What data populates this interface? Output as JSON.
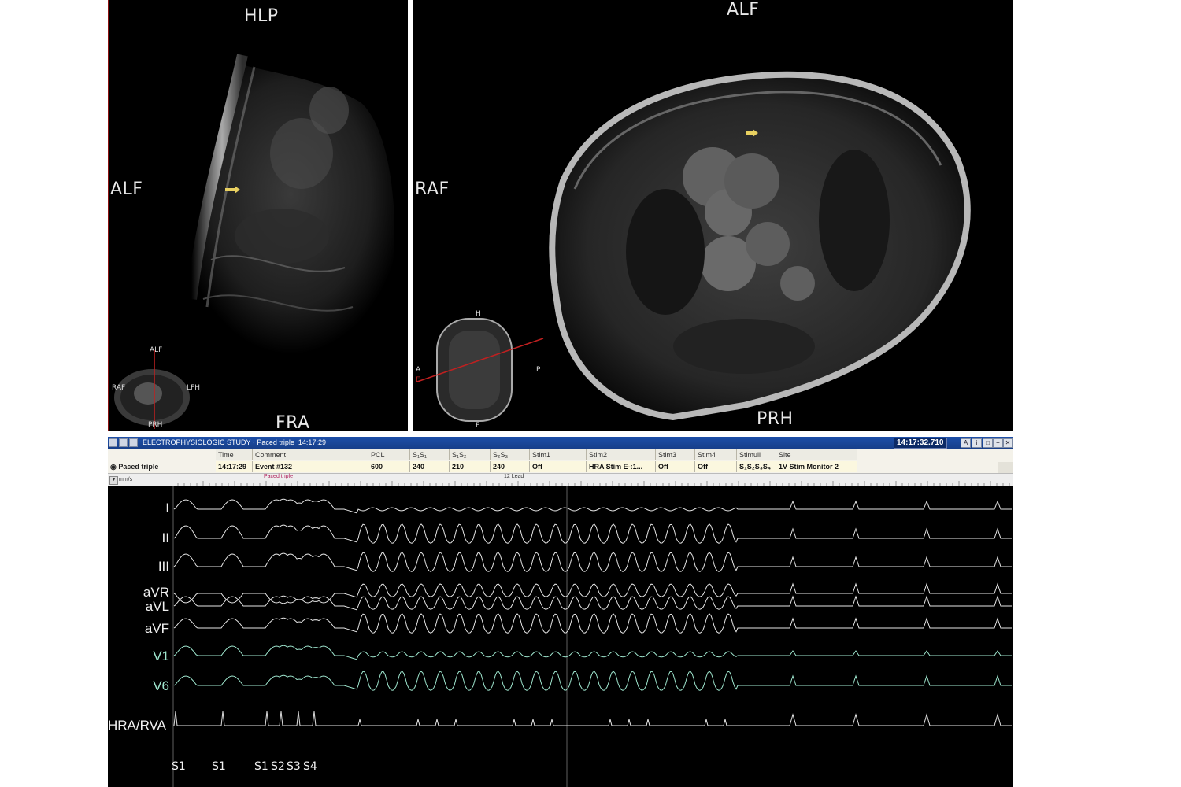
{
  "mri_left": {
    "top_label": "HLP",
    "left_label": "ALF",
    "bottom_label": "FRA",
    "scout": {
      "top": "ALF",
      "left": "RAF",
      "right": "LFH",
      "bottom": "PRH"
    }
  },
  "mri_right": {
    "top_label": "ALF",
    "left_label": "RAF",
    "bottom_label": "PRH",
    "scout": {
      "top": "H",
      "left": "A",
      "right": "P",
      "bottom": "F",
      "line_mark": "E"
    }
  },
  "ep_window": {
    "title": "ELECTROPHYSIOLOGIC STUDY",
    "subtitle": "Paced triple",
    "subtitle_time": "14:17:29",
    "clock": "14:17:32.710",
    "row_name": "Paced triple",
    "columns": [
      "Time",
      "Comment",
      "PCL",
      "S₁S₁",
      "S₁S₂",
      "S₂S₃",
      "Stim1",
      "Stim2",
      "Stim3",
      "Stim4",
      "Stimuli",
      "Site"
    ],
    "values": [
      "14:17:29",
      "Event #132",
      "600",
      "240",
      "210",
      "240",
      "Off",
      "HRA Stim E-:1...",
      "Off",
      "Off",
      "S₁S₂S₃S₄",
      "1V Stim Monitor 2"
    ],
    "units": "mm/s",
    "marker_label": "Paced triple",
    "center_label": "12 Lead",
    "leads": [
      "I",
      "II",
      "III",
      "aVR",
      "aVL",
      "aVF",
      "V1",
      "V6",
      "HRA/RVA"
    ],
    "stimuli": [
      "S1",
      "S1",
      "S1",
      "S2",
      "S3",
      "S4"
    ],
    "colors": {
      "titlebar": "#1d4fa8",
      "trace": "#e6e6e6",
      "trace_green": "#9fe7cf",
      "marker": "#b0205a",
      "arrow": "#e8d060"
    }
  }
}
